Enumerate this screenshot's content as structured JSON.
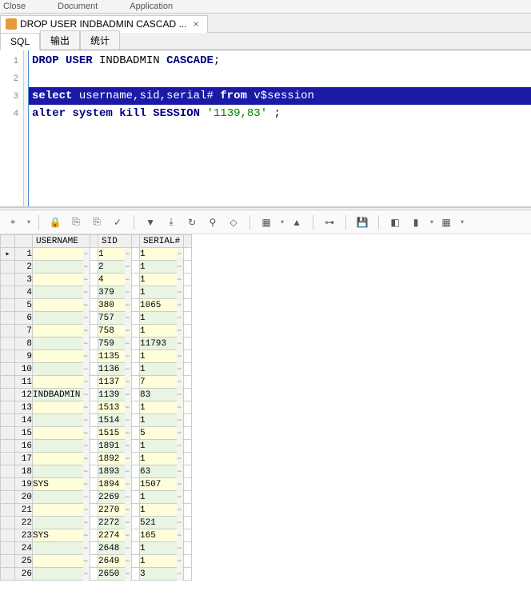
{
  "topMenu": {
    "close": "Close",
    "document": "Document",
    "application": "Application"
  },
  "fileTab": {
    "title": "DROP USER INDBADMIN CASCAD ...",
    "closeGlyph": "×"
  },
  "viewTabs": [
    {
      "label": "SQL",
      "active": true
    },
    {
      "label": "输出",
      "active": false
    },
    {
      "label": "统计",
      "active": false
    }
  ],
  "editor": {
    "lines": [
      {
        "n": 1,
        "tokens": [
          {
            "t": "DROP",
            "c": "kw"
          },
          {
            "t": " ",
            "c": ""
          },
          {
            "t": "USER",
            "c": "kw"
          },
          {
            "t": " ",
            "c": ""
          },
          {
            "t": "INDBADMIN",
            "c": "ident"
          },
          {
            "t": " ",
            "c": ""
          },
          {
            "t": "CASCADE",
            "c": "kw"
          },
          {
            "t": ";",
            "c": ""
          }
        ],
        "selected": false
      },
      {
        "n": 2,
        "tokens": [],
        "selected": false
      },
      {
        "n": 3,
        "tokens": [
          {
            "t": "select",
            "c": "kw"
          },
          {
            "t": " ",
            "c": ""
          },
          {
            "t": "username,sid,serial#",
            "c": "ident"
          },
          {
            "t": " ",
            "c": ""
          },
          {
            "t": "from",
            "c": "kw"
          },
          {
            "t": " ",
            "c": ""
          },
          {
            "t": "v$session",
            "c": "ident"
          }
        ],
        "selected": true
      },
      {
        "n": 4,
        "tokens": [
          {
            "t": "alter",
            "c": "kw"
          },
          {
            "t": " ",
            "c": ""
          },
          {
            "t": "system",
            "c": "kw"
          },
          {
            "t": " ",
            "c": ""
          },
          {
            "t": "kill",
            "c": "kw"
          },
          {
            "t": " ",
            "c": ""
          },
          {
            "t": "SESSION",
            "c": "kw"
          },
          {
            "t": " ",
            "c": ""
          },
          {
            "t": "'1139,83'",
            "c": "str"
          },
          {
            "t": " ;",
            "c": ""
          }
        ],
        "selected": false
      }
    ]
  },
  "grid": {
    "headers": [
      "USERNAME",
      "SID",
      "SERIAL#"
    ],
    "rows": [
      {
        "n": 1,
        "username": "",
        "sid": "1",
        "serial": "1",
        "ptr": true
      },
      {
        "n": 2,
        "username": "",
        "sid": "2",
        "serial": "1"
      },
      {
        "n": 3,
        "username": "",
        "sid": "4",
        "serial": "1"
      },
      {
        "n": 4,
        "username": "",
        "sid": "379",
        "serial": "1"
      },
      {
        "n": 5,
        "username": "",
        "sid": "380",
        "serial": "1065"
      },
      {
        "n": 6,
        "username": "",
        "sid": "757",
        "serial": "1"
      },
      {
        "n": 7,
        "username": "",
        "sid": "758",
        "serial": "1"
      },
      {
        "n": 8,
        "username": "",
        "sid": "759",
        "serial": "11793"
      },
      {
        "n": 9,
        "username": "",
        "sid": "1135",
        "serial": "1"
      },
      {
        "n": 10,
        "username": "",
        "sid": "1136",
        "serial": "1"
      },
      {
        "n": 11,
        "username": "",
        "sid": "1137",
        "serial": "7"
      },
      {
        "n": 12,
        "username": "INDBADMIN",
        "sid": "1139",
        "serial": "83"
      },
      {
        "n": 13,
        "username": "",
        "sid": "1513",
        "serial": "1"
      },
      {
        "n": 14,
        "username": "",
        "sid": "1514",
        "serial": "1"
      },
      {
        "n": 15,
        "username": "",
        "sid": "1515",
        "serial": "5"
      },
      {
        "n": 16,
        "username": "",
        "sid": "1891",
        "serial": "1"
      },
      {
        "n": 17,
        "username": "",
        "sid": "1892",
        "serial": "1"
      },
      {
        "n": 18,
        "username": "",
        "sid": "1893",
        "serial": "63"
      },
      {
        "n": 19,
        "username": "SYS",
        "sid": "1894",
        "serial": "1507"
      },
      {
        "n": 20,
        "username": "",
        "sid": "2269",
        "serial": "1"
      },
      {
        "n": 21,
        "username": "",
        "sid": "2270",
        "serial": "1"
      },
      {
        "n": 22,
        "username": "",
        "sid": "2272",
        "serial": "521"
      },
      {
        "n": 23,
        "username": "SYS",
        "sid": "2274",
        "serial": "165"
      },
      {
        "n": 24,
        "username": "",
        "sid": "2648",
        "serial": "1"
      },
      {
        "n": 25,
        "username": "",
        "sid": "2649",
        "serial": "1"
      },
      {
        "n": 26,
        "username": "",
        "sid": "2650",
        "serial": "3"
      }
    ]
  },
  "toolbarIcons": {
    "target": "⌖",
    "lock": "🔒",
    "copyOut": "⎘",
    "copyIn": "⎘",
    "check": "✓",
    "down": "▼",
    "dblDown": "⤓",
    "refresh": "↻",
    "find": "⚲",
    "erase": "◇",
    "layout": "▦",
    "up": "▲",
    "tree": "⊶",
    "save": "💾",
    "col": "◧",
    "chart": "▮",
    "grid": "▦"
  }
}
